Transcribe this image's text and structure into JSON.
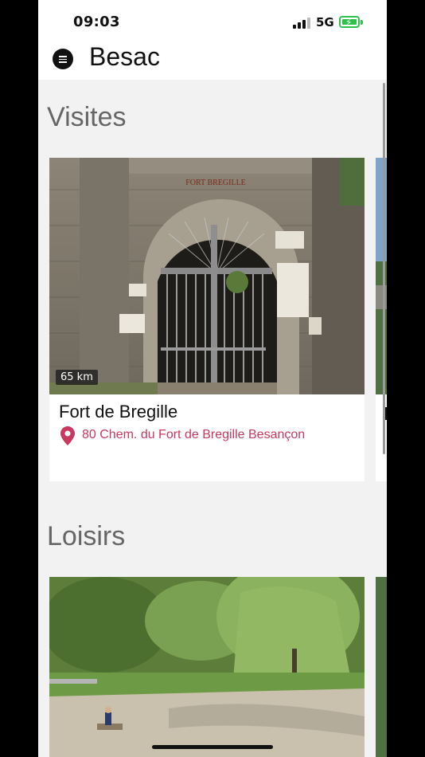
{
  "status_bar": {
    "time": "09:03",
    "network": "5G"
  },
  "app": {
    "title": "Besac"
  },
  "sections": [
    {
      "title": "Visites",
      "card": {
        "name": "Fort de Bregille",
        "address": "80 Chem. du Fort de Bregille Besançon",
        "distance": "65 km",
        "sign": "FORT BREGILLE"
      }
    },
    {
      "title": "Loisirs"
    }
  ],
  "colors": {
    "accent": "#c8385f",
    "background": "#f2f2f2",
    "battery": "#2ec24a"
  },
  "icons": {
    "menu": "menu-icon",
    "pin": "location-pin-icon",
    "battery": "battery-charging-icon",
    "signal": "cellular-signal-icon"
  }
}
